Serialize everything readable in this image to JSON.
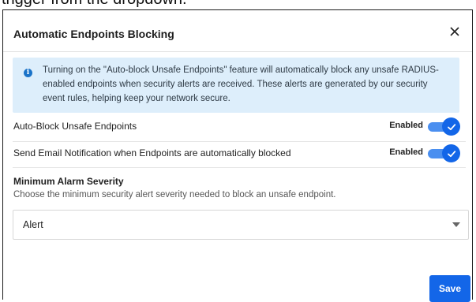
{
  "top_strip": {
    "text": "trigger from the dropdown."
  },
  "dialog": {
    "title": "Automatic Endpoints Blocking",
    "close_label": "×"
  },
  "info": {
    "icon": "info-icon",
    "text": "Turning on the \"Auto-block Unsafe Endpoints\" feature will automatically block any unsafe RADIUS-enabled endpoints when security alerts are received. These alerts are generated by our security event rules, helping keep your network secure."
  },
  "settings": [
    {
      "label": "Auto-Block Unsafe Endpoints",
      "status": "Enabled",
      "enabled": true
    },
    {
      "label": "Send Email Notification when Endpoints are automatically blocked",
      "status": "Enabled",
      "enabled": true
    }
  ],
  "severity": {
    "title": "Minimum Alarm Severity",
    "description": "Choose the minimum security alert severity needed to block an unsafe endpoint.",
    "selected": "Alert"
  },
  "actions": {
    "save_label": "Save"
  },
  "colors": {
    "accent": "#1366e8",
    "info_bg": "#ddeefb"
  }
}
